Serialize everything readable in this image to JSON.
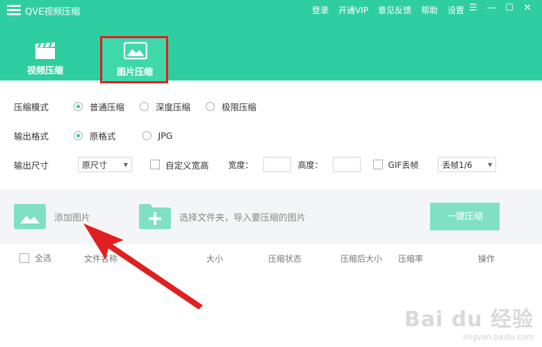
{
  "window": {
    "title": "QVE视频压缩",
    "nav": [
      "登录",
      "开通VIP",
      "意见反馈",
      "帮助",
      "设置"
    ],
    "controls": [
      "☰",
      "—",
      "☐",
      "✕"
    ]
  },
  "tabs": {
    "video": "视频压缩",
    "image": "图片压缩"
  },
  "settings": {
    "mode": {
      "label": "压缩模式",
      "options": [
        "普通压缩",
        "深度压缩",
        "极限压缩"
      ],
      "selected": "普通压缩"
    },
    "format": {
      "label": "输出格式",
      "options": [
        "原格式",
        "JPG"
      ],
      "selected": "原格式"
    },
    "size": {
      "label": "输出尺寸",
      "select_value": "原尺寸",
      "custom_label": "自定义宽高",
      "width_label": "宽度：",
      "height_label": "高度：",
      "gif_label": "GIF丢帧",
      "gif_select": "丢帧1/6"
    }
  },
  "dropzone": {
    "add_image": "添加图片",
    "folder_hint": "选择文件夹，导入要压缩的图片",
    "compress_button": "一键压缩"
  },
  "table": {
    "select_all": "全选",
    "columns": [
      "文件名称",
      "大小",
      "压缩状态",
      "压缩后大小",
      "压缩率",
      "操作"
    ]
  },
  "watermark": {
    "logo": "Bai du 经验",
    "url": "jingyan.baidu.com"
  },
  "colors": {
    "primary": "#2fcea0",
    "light_accent": "#7fe0c4",
    "highlight": "#e01e1e"
  }
}
